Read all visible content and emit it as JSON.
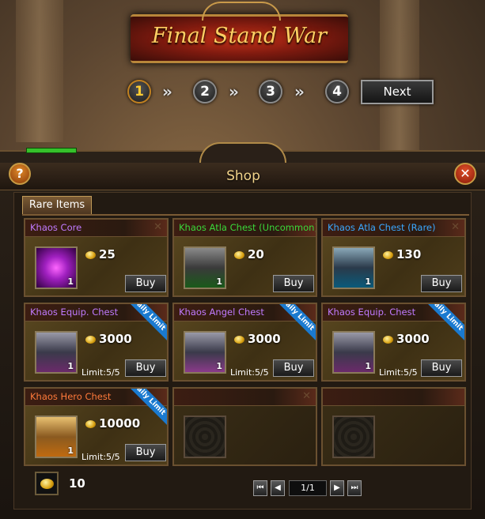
{
  "banner": {
    "title": "Final Stand War"
  },
  "steps": [
    "1",
    "2",
    "3",
    "4"
  ],
  "next_label": "Next",
  "panel": {
    "title": "Shop",
    "help_icon": "?",
    "close_icon": "✕"
  },
  "tab": {
    "label": "Rare Items"
  },
  "daily_label": "Daily Limit",
  "buy_label": "Buy",
  "items": [
    {
      "name": "Khaos Core",
      "name_color": "#c07aff",
      "price": "25",
      "qty": "1",
      "limit": "",
      "daily": false
    },
    {
      "name": "Khaos Atla Chest (Uncommon)",
      "name_color": "#3ad83a",
      "price": "20",
      "qty": "1",
      "limit": "",
      "daily": false
    },
    {
      "name": "Khaos Atla Chest (Rare)",
      "name_color": "#3aa8ff",
      "price": "130",
      "qty": "1",
      "limit": "",
      "daily": false
    },
    {
      "name": "Khaos Equip. Chest",
      "name_color": "#c07aff",
      "price": "3000",
      "qty": "1",
      "limit": "Limit:5/5",
      "daily": true
    },
    {
      "name": "Khaos Angel Chest",
      "name_color": "#c07aff",
      "price": "3000",
      "qty": "1",
      "limit": "Limit:5/5",
      "daily": true
    },
    {
      "name": "Khaos Equip. Chest",
      "name_color": "#c07aff",
      "price": "3000",
      "qty": "1",
      "limit": "Limit:5/5",
      "daily": true
    },
    {
      "name": "Khaos Hero Chest",
      "name_color": "#ff7a3a",
      "price": "10000",
      "qty": "1",
      "limit": "Limit:5/5",
      "daily": true
    }
  ],
  "footer": {
    "currency": "10",
    "page": "1/1"
  },
  "pager": {
    "first": "⏮",
    "prev": "◀",
    "next": "▶",
    "last": "⏭"
  }
}
